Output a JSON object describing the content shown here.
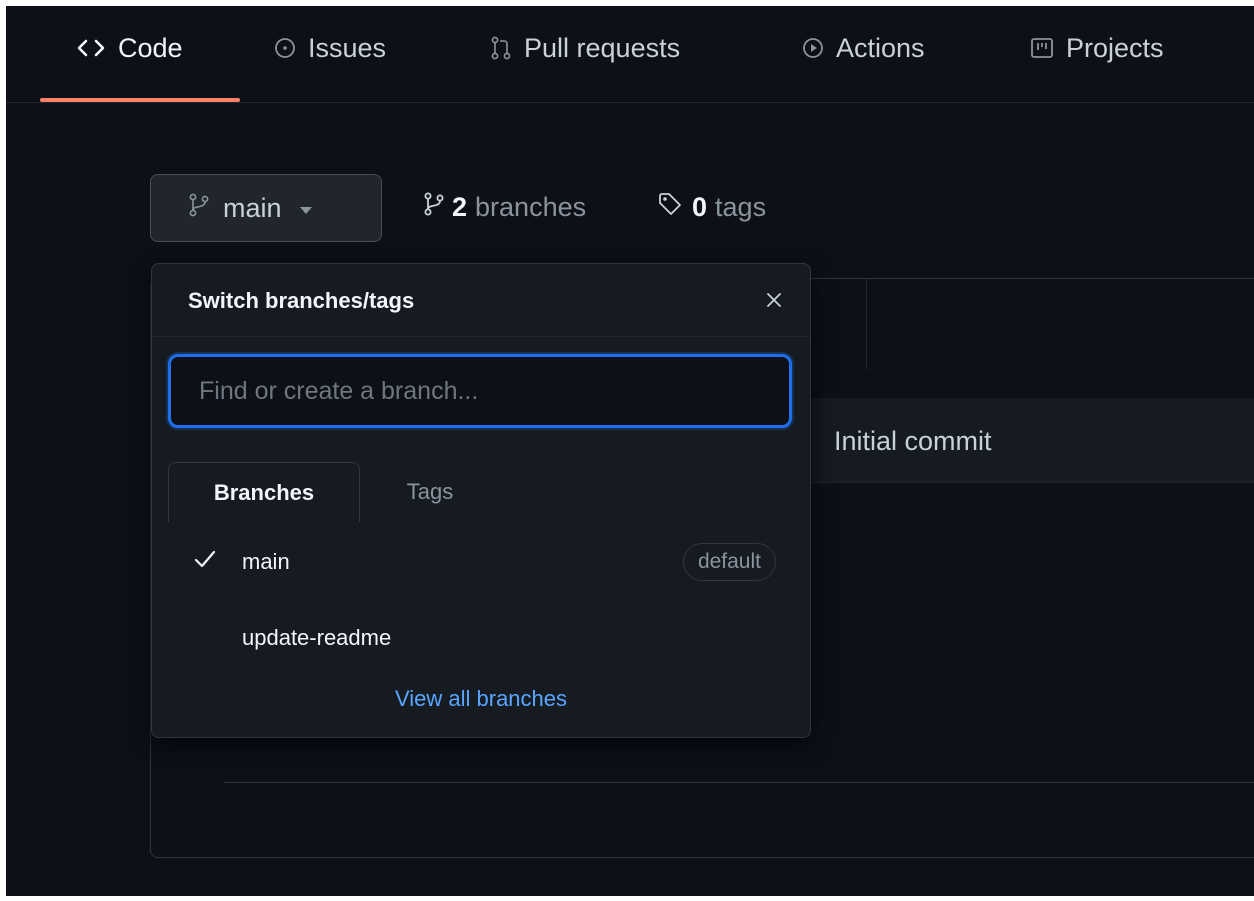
{
  "nav": {
    "tabs": [
      {
        "label": "Code",
        "icon": "code-icon",
        "selected": true
      },
      {
        "label": "Issues",
        "icon": "issue-opened-icon",
        "selected": false
      },
      {
        "label": "Pull requests",
        "icon": "git-pull-request-icon",
        "selected": false
      },
      {
        "label": "Actions",
        "icon": "play-icon",
        "selected": false
      },
      {
        "label": "Projects",
        "icon": "table-icon",
        "selected": false
      }
    ]
  },
  "repo": {
    "branch_button_label": "main",
    "branches_count": "2",
    "branches_label": "branches",
    "tags_count": "0",
    "tags_label": "tags",
    "commit_message": "Initial commit"
  },
  "dropdown": {
    "title": "Switch branches/tags",
    "filter_placeholder": "Find or create a branch...",
    "tabs": {
      "branches": "Branches",
      "tags": "Tags"
    },
    "items": [
      {
        "name": "main",
        "checked": true,
        "badge": "default"
      },
      {
        "name": "update-readme",
        "checked": false,
        "badge": ""
      }
    ],
    "view_all": "View all branches"
  },
  "colors": {
    "background": "#0d1117",
    "accent_underline": "#f78166",
    "focus_ring": "#1f6feb",
    "link": "#58a6ff"
  }
}
